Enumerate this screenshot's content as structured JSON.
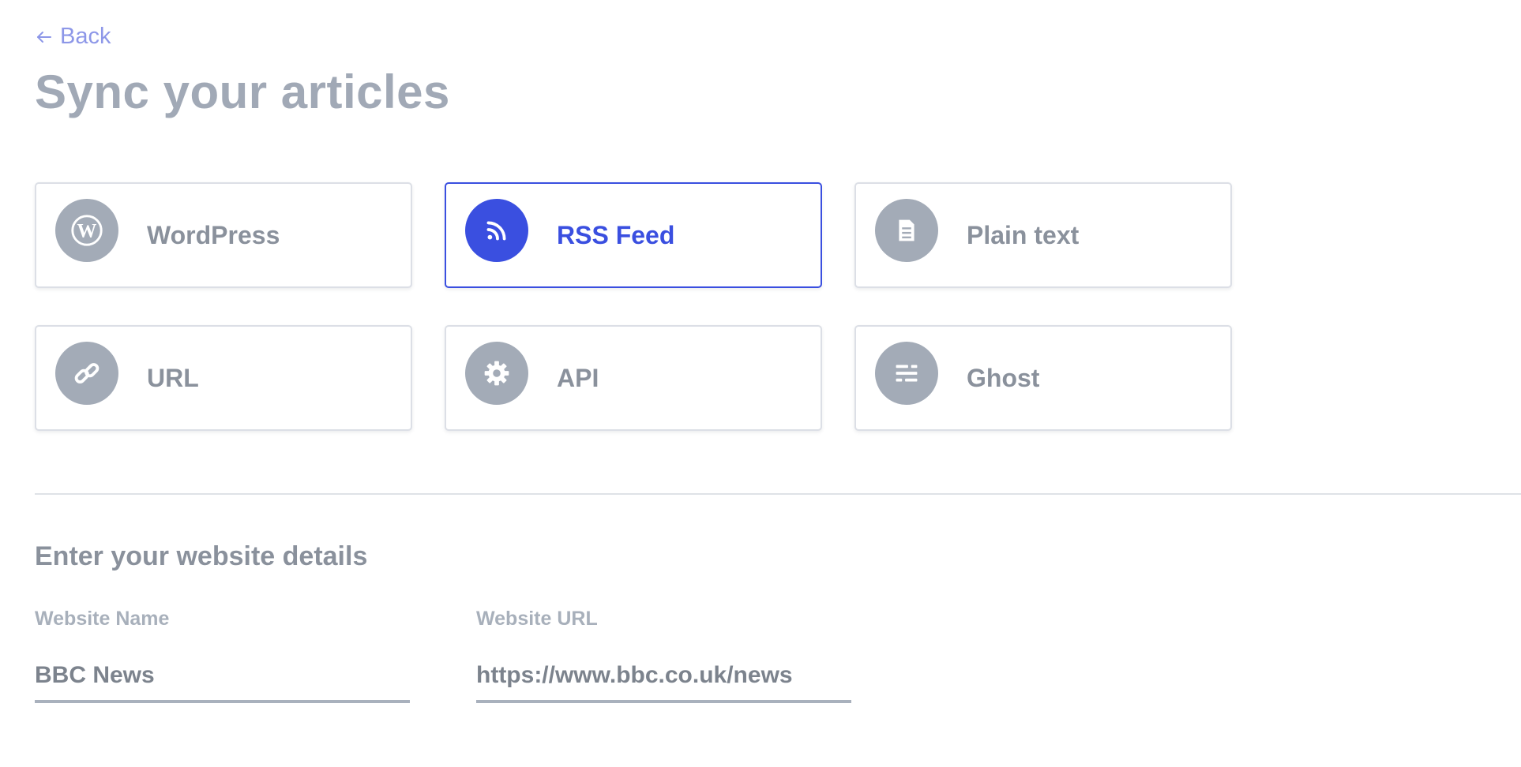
{
  "header": {
    "back_label": "Back",
    "title": "Sync your articles"
  },
  "sources": {
    "selected": "RSS Feed",
    "items": [
      {
        "label": "WordPress",
        "icon": "wordpress-icon"
      },
      {
        "label": "RSS Feed",
        "icon": "rss-icon"
      },
      {
        "label": "Plain text",
        "icon": "document-icon"
      },
      {
        "label": "URL",
        "icon": "link-icon"
      },
      {
        "label": "API",
        "icon": "gear-icon"
      },
      {
        "label": "Ghost",
        "icon": "ghost-icon"
      }
    ]
  },
  "details": {
    "section_title": "Enter your website details",
    "website_name": {
      "label": "Website Name",
      "value": "BBC News"
    },
    "website_url": {
      "label": "Website URL",
      "value": "https://www.bbc.co.uk/news"
    }
  },
  "colors": {
    "accent": "#3a4fe0",
    "back_link": "#8d97e8",
    "icon_inactive": "#a3abb7",
    "text_muted": "#8a919c"
  }
}
